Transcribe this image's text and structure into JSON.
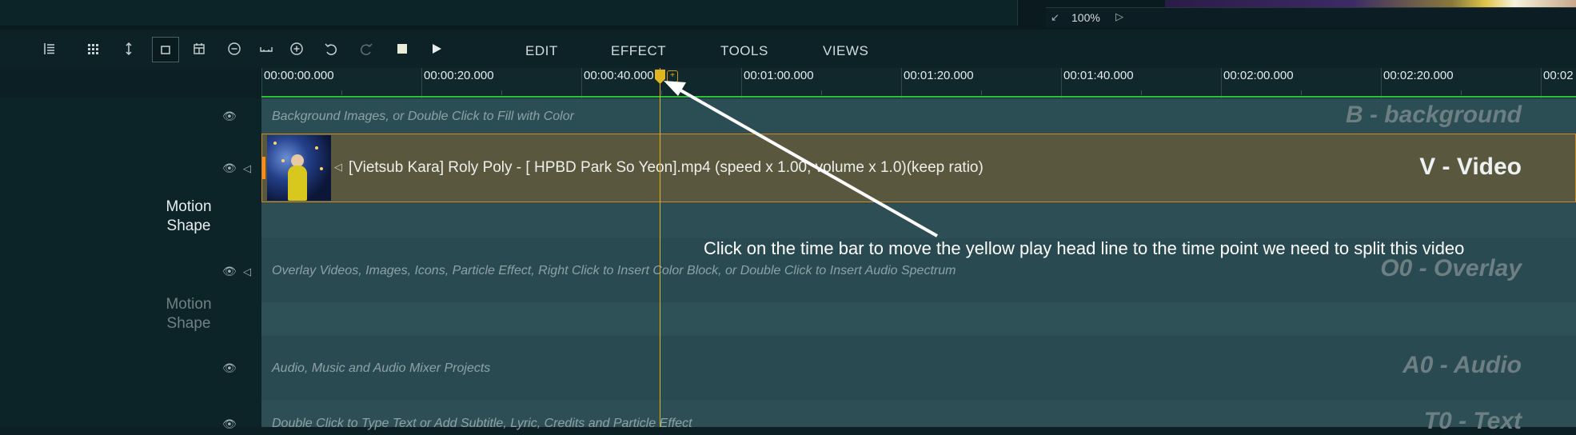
{
  "zoom": {
    "level": "100%"
  },
  "toolbar": {
    "menus": [
      "EDIT",
      "EFFECT",
      "TOOLS",
      "VIEWS"
    ]
  },
  "ruler": {
    "labels": [
      "00:00:00.000",
      "00:00:20.000",
      "00:00:40.000",
      "00:01:00.000",
      "00:01:20.000",
      "00:01:40.000",
      "00:02:00.000",
      "00:02:20.000",
      "00:02"
    ]
  },
  "tracks": {
    "background": {
      "name": "B - background",
      "hint": "Background Images, or Double Click to Fill with Color"
    },
    "video": {
      "name": "V - Video",
      "clip_title": "[Vietsub Kara] Roly Poly - [ HPBD Park So Yeon].mp4  (speed x 1.00, volume x 1.0)(keep ratio)",
      "motion_label": "Motion",
      "shape_label": "Shape"
    },
    "overlay": {
      "name": "O0 - Overlay",
      "hint": "Overlay Videos, Images, Icons, Particle Effect, Right Click to Insert Color Block, or Double Click to Insert Audio Spectrum",
      "motion_label": "Motion",
      "shape_label": "Shape"
    },
    "audio": {
      "name": "A0 - Audio",
      "hint": "Audio, Music and Audio Mixer Projects"
    },
    "text": {
      "name": "T0 - Text",
      "hint": "Double Click to Type Text or Add Subtitle, Lyric, Credits and Particle Effect"
    }
  },
  "annotation": {
    "callout": "Click on the time bar to move the yellow play head line to the time point we need to split this video"
  },
  "colors": {
    "playhead": "#e0b520",
    "clip_border": "#c98a2a",
    "timeline_progress": "#2fbf3a"
  },
  "icons": [
    "track-list-icon",
    "grid-icon",
    "vertical-resize-icon",
    "select-box-icon",
    "calendar-icon",
    "zoom-out-icon",
    "fit-icon",
    "zoom-in-icon",
    "undo-icon",
    "redo-icon",
    "stop-icon",
    "play-icon"
  ]
}
